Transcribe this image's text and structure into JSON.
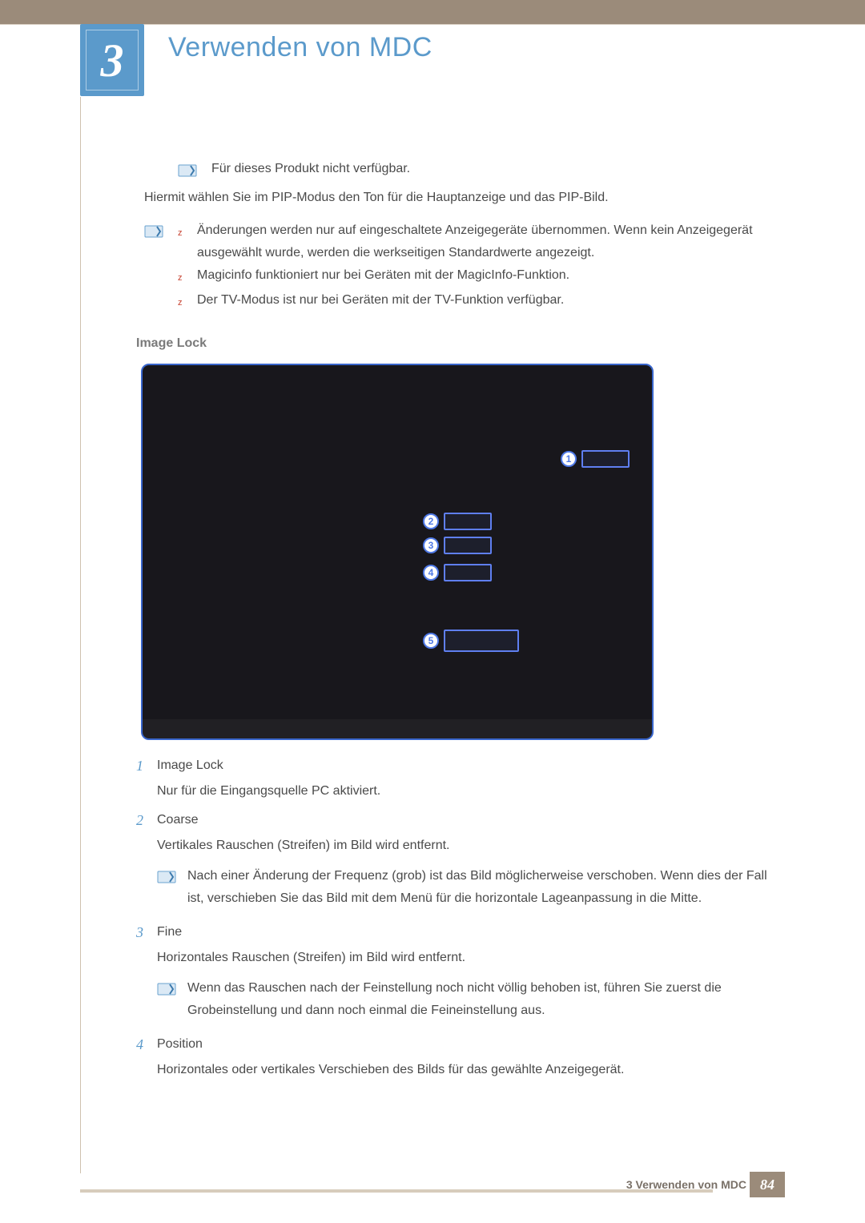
{
  "chapter": {
    "number": "3",
    "title": "Verwenden von MDC"
  },
  "intro": {
    "note1": "Für dieses Produkt nicht verfügbar.",
    "text": "Hiermit wählen Sie im PIP-Modus den Ton für die Hauptanzeige und das PIP-Bild.",
    "notes": [
      "Änderungen werden nur auf eingeschaltete Anzeigegeräte übernommen. Wenn kein Anzeigegerät ausgewählt wurde, werden die werkseitigen Standardwerte angezeigt.",
      "Magicinfo funktioniert nur bei Geräten mit der MagicInfo-Funktion.",
      "Der TV-Modus ist nur bei Geräten mit der TV-Funktion verfügbar."
    ]
  },
  "section": {
    "heading": "Image Lock"
  },
  "list": [
    {
      "num": "1",
      "title": "Image Lock",
      "desc": "Nur für die Eingangsquelle PC aktiviert."
    },
    {
      "num": "2",
      "title": "Coarse",
      "desc": "Vertikales Rauschen (Streifen) im Bild wird entfernt.",
      "note": "Nach einer Änderung der Frequenz (grob) ist das Bild möglicherweise verschoben. Wenn dies der Fall ist, verschieben Sie das Bild mit dem Menü für die horizontale Lageanpassung in die Mitte."
    },
    {
      "num": "3",
      "title": "Fine",
      "desc": "Horizontales Rauschen (Streifen) im Bild wird entfernt.",
      "note": "Wenn das Rauschen nach der Feinstellung noch nicht völlig behoben ist, führen Sie zuerst die Grobeinstellung und dann noch einmal die Feineinstellung aus."
    },
    {
      "num": "4",
      "title": "Position",
      "desc": "Horizontales oder vertikales Verschieben des Bilds für das gewählte Anzeigegerät."
    }
  ],
  "callouts": {
    "1": "1",
    "2": "2",
    "3": "3",
    "4": "4",
    "5": "5"
  },
  "footer": {
    "label": "3 Verwenden von MDC",
    "page": "84"
  }
}
